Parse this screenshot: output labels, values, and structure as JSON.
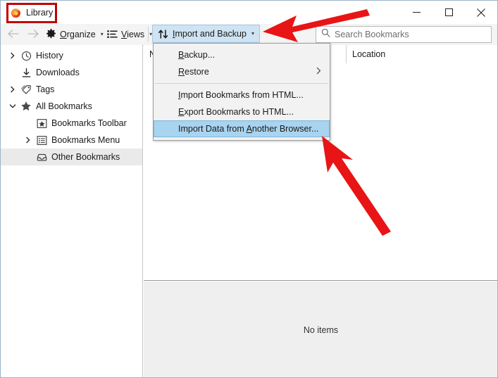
{
  "window": {
    "title": "Library",
    "app_icon": "firefox-icon",
    "controls": {
      "minimize": "minimize-icon",
      "maximize": "maximize-icon",
      "close": "close-icon"
    }
  },
  "toolbar": {
    "back": "back-arrow-icon",
    "forward": "forward-arrow-icon",
    "organize_label": "Organize",
    "organize_icon": "gear-icon",
    "views_label": "Views",
    "views_icon": "list-icon",
    "import_label": "Import and Backup",
    "import_icon": "import-export-arrows-icon",
    "dropdown_caret": "chevron-down-icon"
  },
  "search": {
    "icon": "search-icon",
    "placeholder": "Search Bookmarks",
    "value": ""
  },
  "sidebar": {
    "items": [
      {
        "label": "History",
        "icon": "clock-icon",
        "twisty": "collapsed",
        "indent": 0,
        "selected": false
      },
      {
        "label": "Downloads",
        "icon": "download-icon",
        "twisty": "none",
        "indent": 0,
        "selected": false
      },
      {
        "label": "Tags",
        "icon": "tag-icon",
        "twisty": "collapsed",
        "indent": 0,
        "selected": false
      },
      {
        "label": "All Bookmarks",
        "icon": "star-icon",
        "twisty": "expanded",
        "indent": 0,
        "selected": false
      },
      {
        "label": "Bookmarks Toolbar",
        "icon": "boxed-star-icon",
        "twisty": "none",
        "indent": 1,
        "selected": false
      },
      {
        "label": "Bookmarks Menu",
        "icon": "bookmark-list-icon",
        "twisty": "collapsed",
        "indent": 1,
        "selected": false
      },
      {
        "label": "Other Bookmarks",
        "icon": "inbox-tray-icon",
        "twisty": "none",
        "indent": 1,
        "selected": true
      }
    ]
  },
  "columns": {
    "name": "N",
    "location": "Location"
  },
  "list": {
    "empty_text": "No items"
  },
  "menu": {
    "items": [
      {
        "label": "Backup...",
        "type": "item",
        "highlighted": false
      },
      {
        "label": "Restore",
        "type": "submenu",
        "highlighted": false,
        "arrow_icon": "chevron-right-icon"
      },
      {
        "label": "",
        "type": "separator",
        "highlighted": false
      },
      {
        "label": "Import Bookmarks from HTML...",
        "type": "item",
        "highlighted": false
      },
      {
        "label": "Export Bookmarks to HTML...",
        "type": "item",
        "highlighted": false
      },
      {
        "label": "Import Data from Another Browser...",
        "type": "item",
        "highlighted": true
      }
    ]
  },
  "annotations": {
    "highlight_rect_color": "#c00000",
    "arrow_color": "#e81416",
    "arrows": [
      {
        "name": "arrow-to-import-button",
        "points_to": "Import and Backup"
      },
      {
        "name": "arrow-to-import-data-item",
        "points_to": "Import Data from Another Browser..."
      }
    ]
  },
  "colors": {
    "menu_highlight": "#a8d4f0",
    "toolbar_active": "#cfe3f2",
    "footer_bg": "#efefef"
  }
}
